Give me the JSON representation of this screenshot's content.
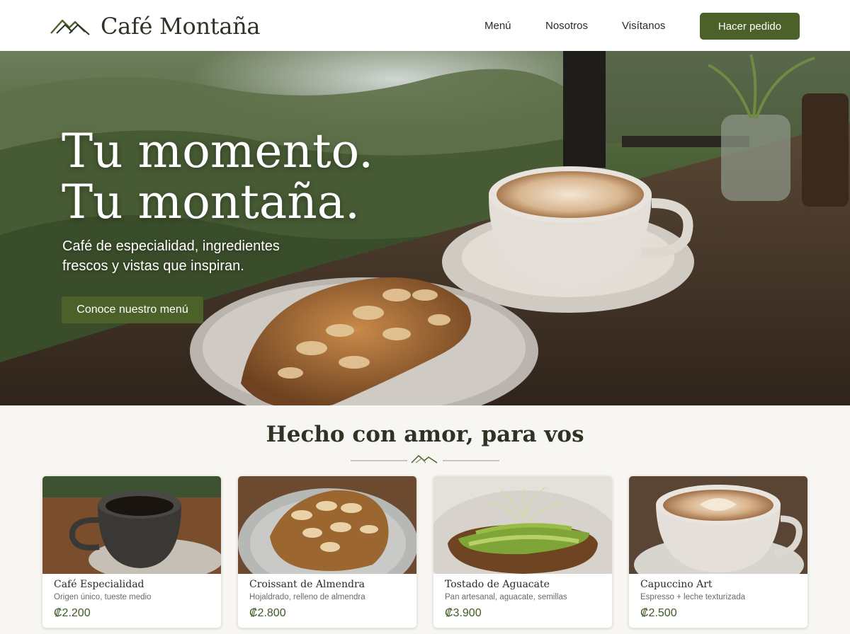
{
  "header": {
    "brand": "Café Montaña",
    "nav": [
      "Menú",
      "Nosotros",
      "Visítanos"
    ],
    "cta_label": "Hacer pedido"
  },
  "hero": {
    "title_line1": "Tu momento.",
    "title_line2": "Tu montaña.",
    "subtitle": "Café de especialidad, ingredientes frescos y vistas que inspiran.",
    "button_label": "Conoce nuestro menú"
  },
  "section": {
    "title": "Hecho con amor, para vos"
  },
  "products": [
    {
      "name": "Café Especialidad",
      "description": "Origen único, tueste medio",
      "price": "₡2.200",
      "image": "black-coffee-cup"
    },
    {
      "name": "Croissant de Almendra",
      "description": "Hojaldrado, relleno de almendra",
      "price": "₡2.800",
      "image": "almond-croissant"
    },
    {
      "name": "Tostado de Aguacate",
      "description": "Pan artesanal, aguacate, semillas",
      "price": "₡3.900",
      "image": "avocado-toast"
    },
    {
      "name": "Capuccino Art",
      "description": "Espresso + leche texturizada",
      "price": "₡2.500",
      "image": "latte-art-cup"
    }
  ],
  "colors": {
    "accent": "#4b6129",
    "price": "#3f5a22",
    "background": "#f7f6f2"
  }
}
